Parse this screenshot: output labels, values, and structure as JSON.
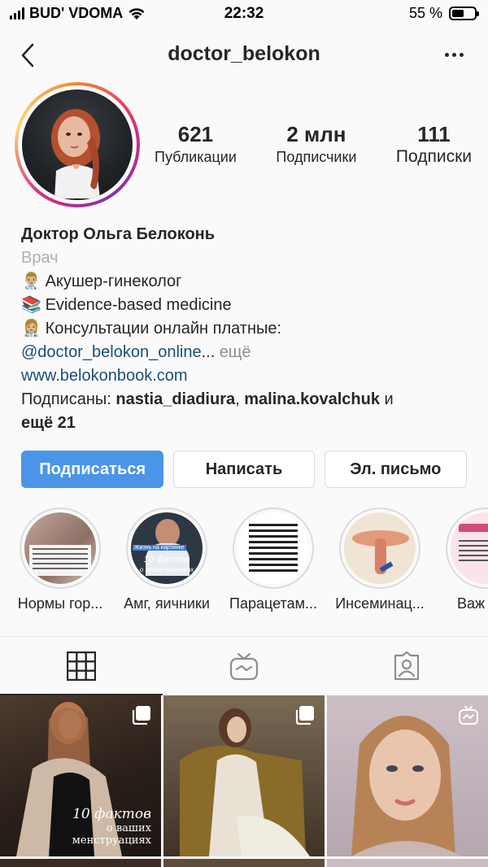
{
  "status_bar": {
    "carrier": "BUD' VDOMA",
    "time": "22:32",
    "battery_percent": "55 %",
    "battery_level": 0.55
  },
  "nav": {
    "username": "doctor_belokon",
    "back_icon": "chevron-left-icon",
    "more_icon": "more-horizontal-icon"
  },
  "stats": [
    {
      "value": "621",
      "label": "Публикации"
    },
    {
      "value": "2 млн",
      "label": "Подписчики"
    },
    {
      "value": "111",
      "label": "Подписки"
    }
  ],
  "bio": {
    "name": "Доктор Ольга Белоконь",
    "category": "Врач",
    "line1": "Акушер-гинеколог",
    "line2": "Evidence-based medicine",
    "line3": "Консультации онлайн платные:",
    "mention": "@doctor_belokon_online",
    "ellipsis": "...",
    "more": " ещё",
    "website": "www.belokonbook.com",
    "followed_prefix": "Подписаны: ",
    "followed_user1": "nastia_diadiura",
    "followed_sep": ", ",
    "followed_user2": "malina.kovalchuk",
    "followed_and": " и",
    "followed_more": "ещё 21"
  },
  "buttons": {
    "follow": "Подписаться",
    "message": "Написать",
    "email": "Эл. письмо"
  },
  "highlights": [
    {
      "label": "Нормы гор..."
    },
    {
      "label": "Амг, яичники"
    },
    {
      "label": "Парацетам..."
    },
    {
      "label": "Инсеминац..."
    },
    {
      "label": "Важ"
    }
  ],
  "highlight_texts": {
    "amg_badge": "Жизнь на картинке",
    "amg_line1": "10 фактов",
    "amg_line2": "о ваших яичниках"
  },
  "tabs": [
    {
      "name": "grid",
      "icon": "grid-icon",
      "active": true
    },
    {
      "name": "igtv",
      "icon": "igtv-icon",
      "active": false
    },
    {
      "name": "tagged",
      "icon": "tagged-user-icon",
      "active": false
    }
  ],
  "posts": [
    {
      "caption_line1": "10 фактов",
      "caption_line2": "о ваших",
      "caption_line3": "менструациях",
      "icon": "multiple-posts-icon"
    },
    {
      "icon": "multiple-posts-icon"
    },
    {
      "icon": "igtv-icon"
    }
  ],
  "colors": {
    "accent": "#4a95e8",
    "link": "#1a4f7a",
    "muted": "#8e8e8e",
    "text": "#262626"
  }
}
